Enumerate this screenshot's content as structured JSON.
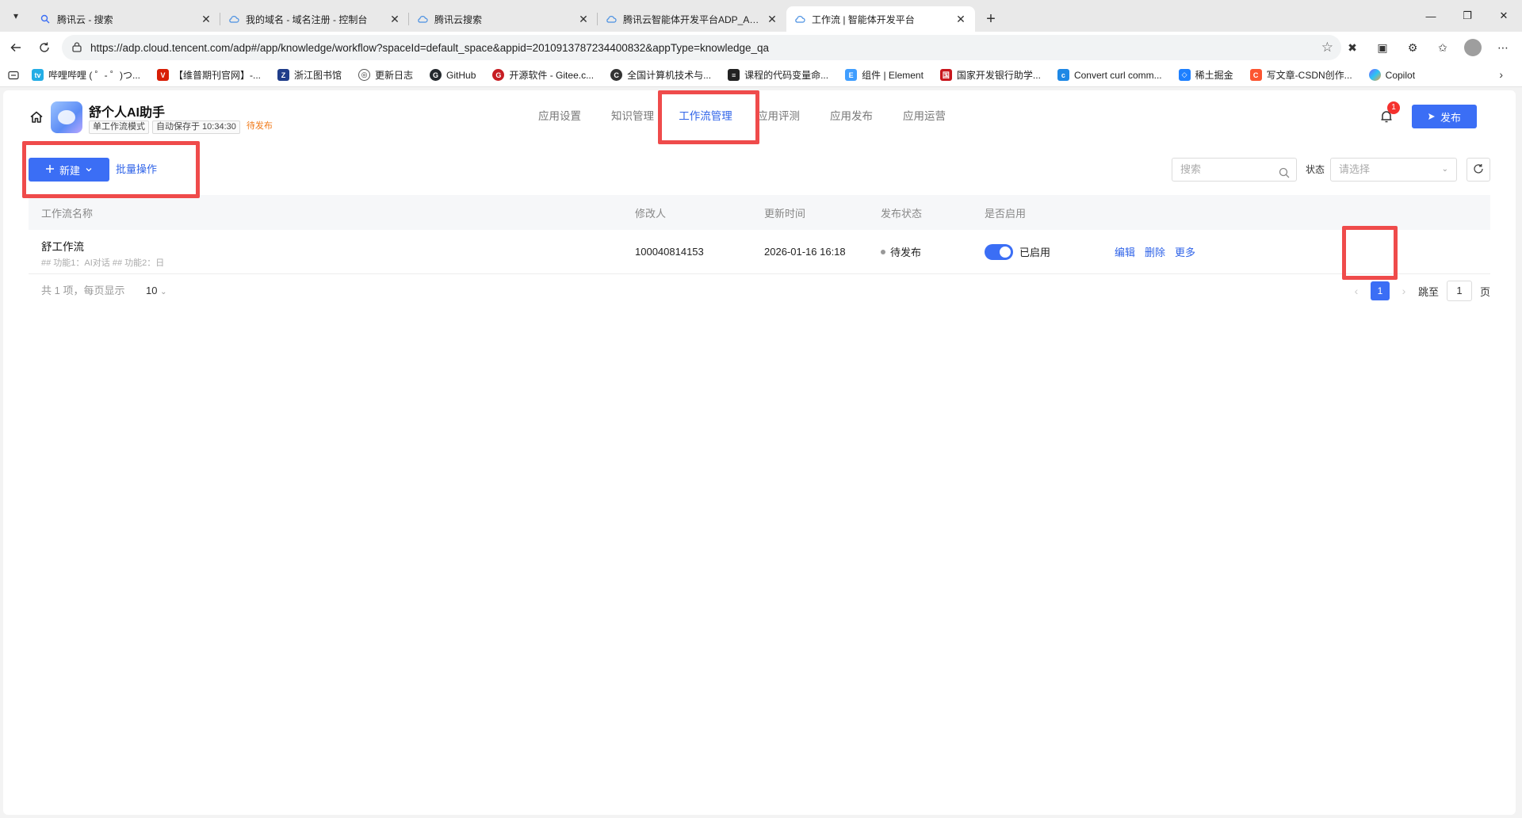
{
  "browser": {
    "tabs": [
      {
        "title": "腾讯云 - 搜索",
        "active": false
      },
      {
        "title": "我的域名 - 域名注册 - 控制台",
        "active": false
      },
      {
        "title": "腾讯云搜索",
        "active": false
      },
      {
        "title": "腾讯云智能体开发平台ADP_Agent",
        "active": false
      },
      {
        "title": "工作流 | 智能体开发平台",
        "active": true
      }
    ],
    "url": "https://adp.cloud.tencent.com/adp#/app/knowledge/workflow?spaceId=default_space&appid=2010913787234400832&appType=knowledge_qa",
    "bookmarks": [
      {
        "label": "哔哩哔哩 ( ゜- ゜)つ...",
        "color": "#23ade5"
      },
      {
        "label": "【维普期刊官网】-...",
        "color": "#d81e06"
      },
      {
        "label": "浙江图书馆",
        "color": "#1f3d8a"
      },
      {
        "label": "更新日志",
        "color": "#555555"
      },
      {
        "label": "GitHub",
        "color": "#24292e"
      },
      {
        "label": "开源软件 - Gitee.c...",
        "color": "#c71d23"
      },
      {
        "label": "全国计算机技术与...",
        "color": "#333333"
      },
      {
        "label": "课程的代码变量命...",
        "color": "#222222"
      },
      {
        "label": "组件 | Element",
        "color": "#409eff"
      },
      {
        "label": "国家开发银行助学...",
        "color": "#c8161d"
      },
      {
        "label": "Convert curl comm...",
        "color": "#1e88e5"
      },
      {
        "label": "稀土掘金",
        "color": "#1e80ff"
      },
      {
        "label": "写文章-CSDN创作...",
        "color": "#fc5531"
      },
      {
        "label": "Copilot",
        "color": "#7b61ff"
      }
    ]
  },
  "app": {
    "name": "舒个人AI助手",
    "mode_tag": "单工作流模式",
    "autosave_tag": "自动保存于 10:34:30",
    "status_tag": "待发布",
    "nav": [
      "应用设置",
      "知识管理",
      "工作流管理",
      "应用评测",
      "应用发布",
      "应用运营"
    ],
    "active_nav": "工作流管理",
    "notification_count": "1",
    "publish_label": "发布"
  },
  "toolbar": {
    "new_label": "新建",
    "batch_label": "批量操作",
    "search_placeholder": "搜索",
    "status_label": "状态",
    "status_placeholder": "请选择"
  },
  "table": {
    "headers": {
      "name": "工作流名称",
      "modifier": "修改人",
      "updated": "更新时间",
      "publish_status": "发布状态",
      "enabled": "是否启用"
    },
    "rows": [
      {
        "name": "舒工作流",
        "desc": "## 功能1：AI对话 ## 功能2：日",
        "modifier": "100040814153",
        "updated": "2026-01-16 16:18",
        "publish_status": "待发布",
        "enabled_label": "已启用",
        "enabled": true,
        "actions": {
          "edit": "编辑",
          "delete": "删除",
          "more": "更多"
        }
      }
    ]
  },
  "pagination": {
    "total_text": "共 1 项，每页显示",
    "page_size": "10",
    "current_page": "1",
    "jump_label": "跳至",
    "jump_value": "1",
    "page_suffix": "页"
  },
  "colors": {
    "primary": "#3b6ef5",
    "highlight": "#ef4b4b",
    "warning_tag": "#f07a19"
  }
}
